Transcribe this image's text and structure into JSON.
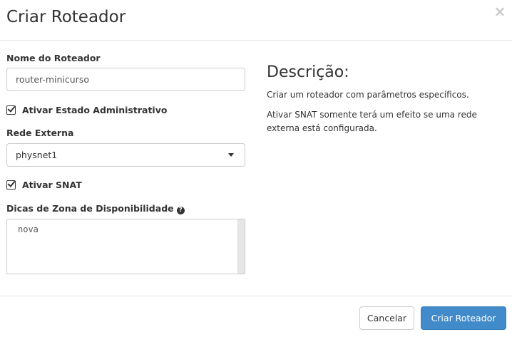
{
  "modal": {
    "title": "Criar Roteador",
    "close_symbol": "×"
  },
  "form": {
    "router_name": {
      "label": "Nome do Roteador",
      "value": "router-minicurso"
    },
    "admin_state": {
      "label": "Ativar Estado Administrativo",
      "checked": true
    },
    "external_network": {
      "label": "Rede Externa",
      "selected": "physnet1"
    },
    "snat": {
      "label": "Ativar SNAT",
      "checked": true
    },
    "availability_zone": {
      "label": "Dicas de Zona de Disponibilidade",
      "help_symbol": "?",
      "value": "nova"
    }
  },
  "description": {
    "title": "Descrição:",
    "paragraphs": [
      "Criar um roteador com parâmetros específicos.",
      "Ativar SNAT somente terá um efeito se uma rede externa está configurada."
    ]
  },
  "footer": {
    "cancel_label": "Cancelar",
    "submit_label": "Criar Roteador"
  },
  "colors": {
    "primary": "#428bca",
    "text": "#333333",
    "border": "#cccccc"
  }
}
